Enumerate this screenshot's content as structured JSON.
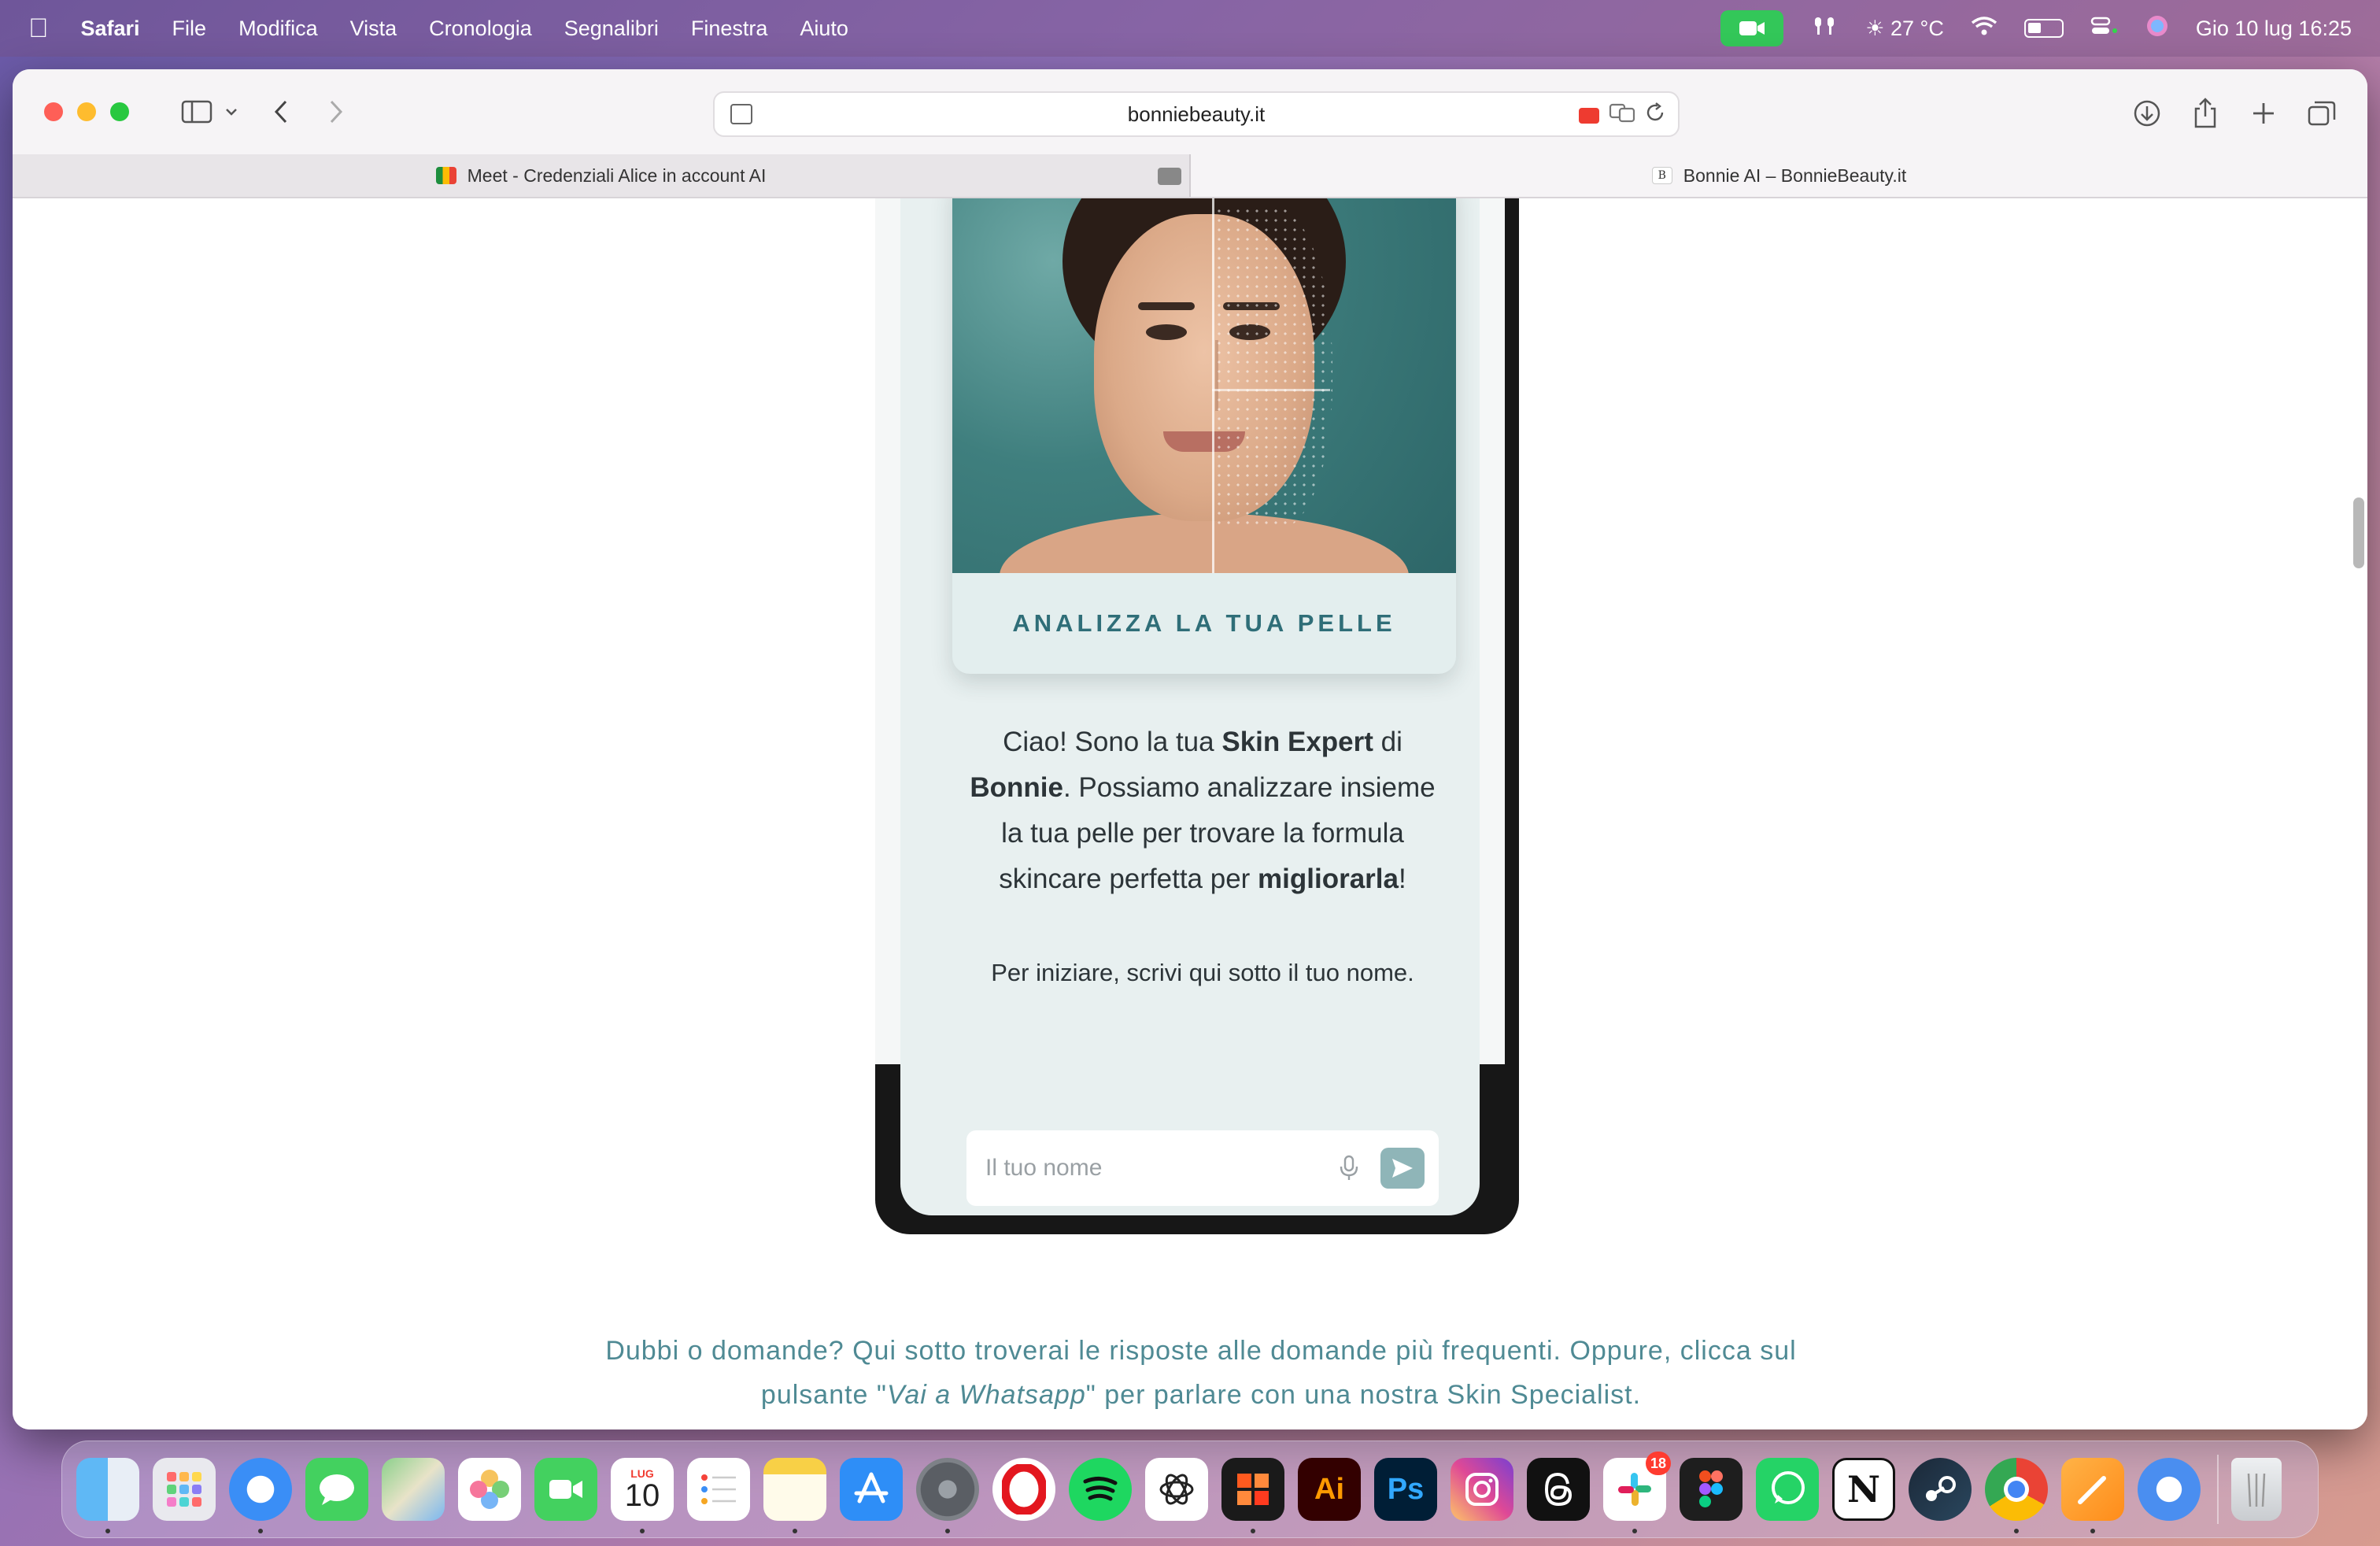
{
  "menubar": {
    "app_name": "Safari",
    "menus": [
      "File",
      "Modifica",
      "Vista",
      "Cronologia",
      "Segnalibri",
      "Finestra",
      "Aiuto"
    ],
    "weather": "27 °C",
    "datetime": "Gio 10 lug  16:25"
  },
  "browser": {
    "url": "bonniebeauty.it",
    "tabs": [
      {
        "title": "Meet - Credenziali Alice in account AI"
      },
      {
        "title": "Bonnie AI – BonnieBeauty.it"
      }
    ]
  },
  "page": {
    "card_title": "ANALIZZA LA TUA PELLE",
    "chat": {
      "p1": "Ciao! Sono la tua ",
      "b1": "Skin Expert",
      "p2": " di ",
      "b2": "Bonnie",
      "p3": ". Possiamo analizzare insieme la tua pelle per trovare la formula skincare perfetta per ",
      "b3": "migliorarla",
      "p4": "!",
      "prompt": "Per iniziare, scrivi qui sotto il tuo nome."
    },
    "name_input": {
      "placeholder": "Il tuo nome",
      "value": ""
    },
    "faq": {
      "t1": "Dubbi o domande? Qui sotto troverai le risposte alle domande più frequenti. Oppure, clicca sul pulsante \"",
      "italic": "Vai a Whatsapp",
      "t2": "\" per parlare con una nostra Skin Specialist."
    }
  },
  "dock": {
    "calendar_month": "LUG",
    "calendar_day": "10",
    "slack_badge": "18",
    "apps": [
      "Finder",
      "Launchpad",
      "Safari",
      "Messaggi",
      "Mappe",
      "Foto",
      "FaceTime",
      "Calendario",
      "Promemoria",
      "Note",
      "App Store",
      "Impostazioni di Sistema",
      "Opera",
      "Spotify",
      "ChatGPT",
      "Affinity",
      "Illustrator",
      "Photoshop",
      "Instagram",
      "Threads",
      "Slack",
      "Figma",
      "WhatsApp",
      "Notion",
      "Steam",
      "Chrome",
      "Pages",
      "Safari Technology Preview",
      "Cestino"
    ]
  }
}
